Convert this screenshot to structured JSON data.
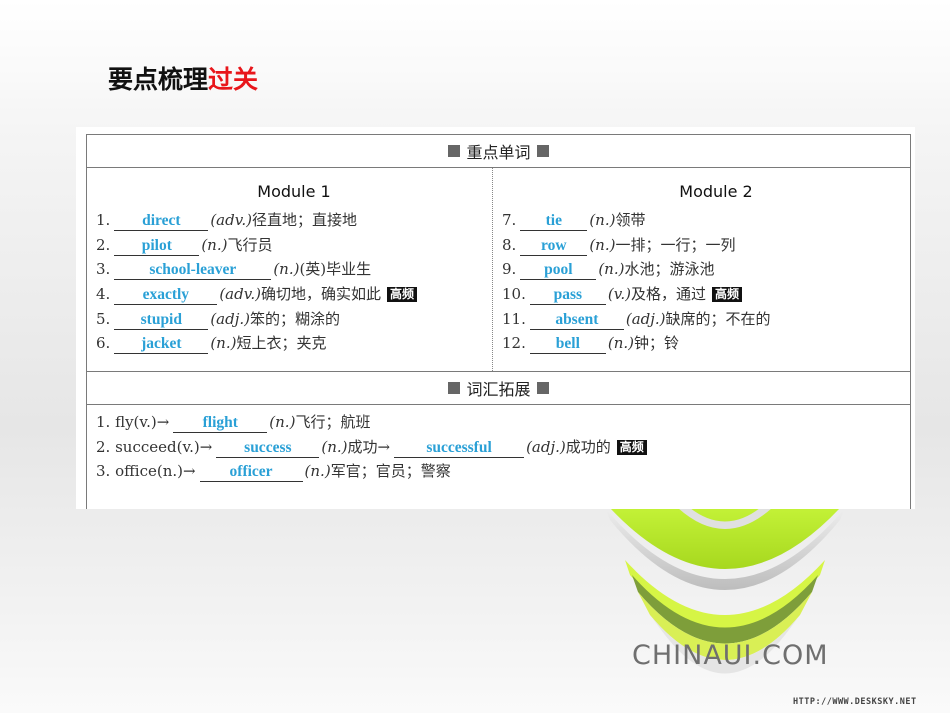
{
  "title": {
    "main": "要点梳理",
    "accent": "过关"
  },
  "sections": {
    "key_words": "重点单词",
    "vocab_ext": "词汇拓展"
  },
  "modules": [
    {
      "name": "Module 1",
      "items": [
        {
          "num": "1.",
          "answer": "direct",
          "pos": "(adv.)",
          "meaning": "径直地；直接地",
          "badge": ""
        },
        {
          "num": "2.",
          "answer": "pilot",
          "pos": "(n.)",
          "meaning": "飞行员",
          "badge": ""
        },
        {
          "num": "3.",
          "answer": "school-leaver",
          "pos": "(n.)",
          "meaning": "(英)毕业生",
          "badge": ""
        },
        {
          "num": "4.",
          "answer": "exactly",
          "pos": "(adv.)",
          "meaning": "确切地，确实如此",
          "badge": "高频"
        },
        {
          "num": "5.",
          "answer": "stupid",
          "pos": "(adj.)",
          "meaning": "笨的；糊涂的",
          "badge": ""
        },
        {
          "num": "6.",
          "answer": "jacket",
          "pos": "(n.)",
          "meaning": "短上衣；夹克",
          "badge": ""
        }
      ]
    },
    {
      "name": "Module 2",
      "items": [
        {
          "num": "7.",
          "answer": "tie",
          "pos": "(n.)",
          "meaning": "领带",
          "badge": ""
        },
        {
          "num": "8.",
          "answer": "row",
          "pos": "(n.)",
          "meaning": "一排；一行；一列",
          "badge": ""
        },
        {
          "num": "9.",
          "answer": "pool",
          "pos": "(n.)",
          "meaning": "水池；游泳池",
          "badge": ""
        },
        {
          "num": "10.",
          "answer": "pass",
          "pos": "(v.)",
          "meaning": "及格，通过",
          "badge": "高频"
        },
        {
          "num": "11.",
          "answer": "absent",
          "pos": "(adj.)",
          "meaning": "缺席的；不在的",
          "badge": ""
        },
        {
          "num": "12.",
          "answer": "bell",
          "pos": "(n.)",
          "meaning": "钟；铃",
          "badge": ""
        }
      ]
    }
  ],
  "extensions": [
    {
      "prefix": "1. fly(v.)→",
      "answer": "flight",
      "pos": "(n.)",
      "meaning": "飞行；航班",
      "answer2": "",
      "pos2": "",
      "meaning2": "",
      "badge": ""
    },
    {
      "prefix": "2. succeed(v.)→",
      "answer": "success",
      "pos": "(n.)",
      "meaning": "成功→",
      "answer2": "successful",
      "pos2": "(adj.)",
      "meaning2": "成功的",
      "badge": "高频"
    },
    {
      "prefix": "3. office(n.)→",
      "answer": "officer",
      "pos": "(n.)",
      "meaning": "军官；官员；警察",
      "answer2": "",
      "pos2": "",
      "meaning2": "",
      "badge": ""
    }
  ],
  "branding": {
    "logo_text": "CHINAUI.COM",
    "watermark": "HTTP://WWW.DESKSKY.NET"
  },
  "colors": {
    "accent_red": "#e8161b",
    "answer_blue": "#2aa0d6",
    "badge_bg": "#111111"
  }
}
